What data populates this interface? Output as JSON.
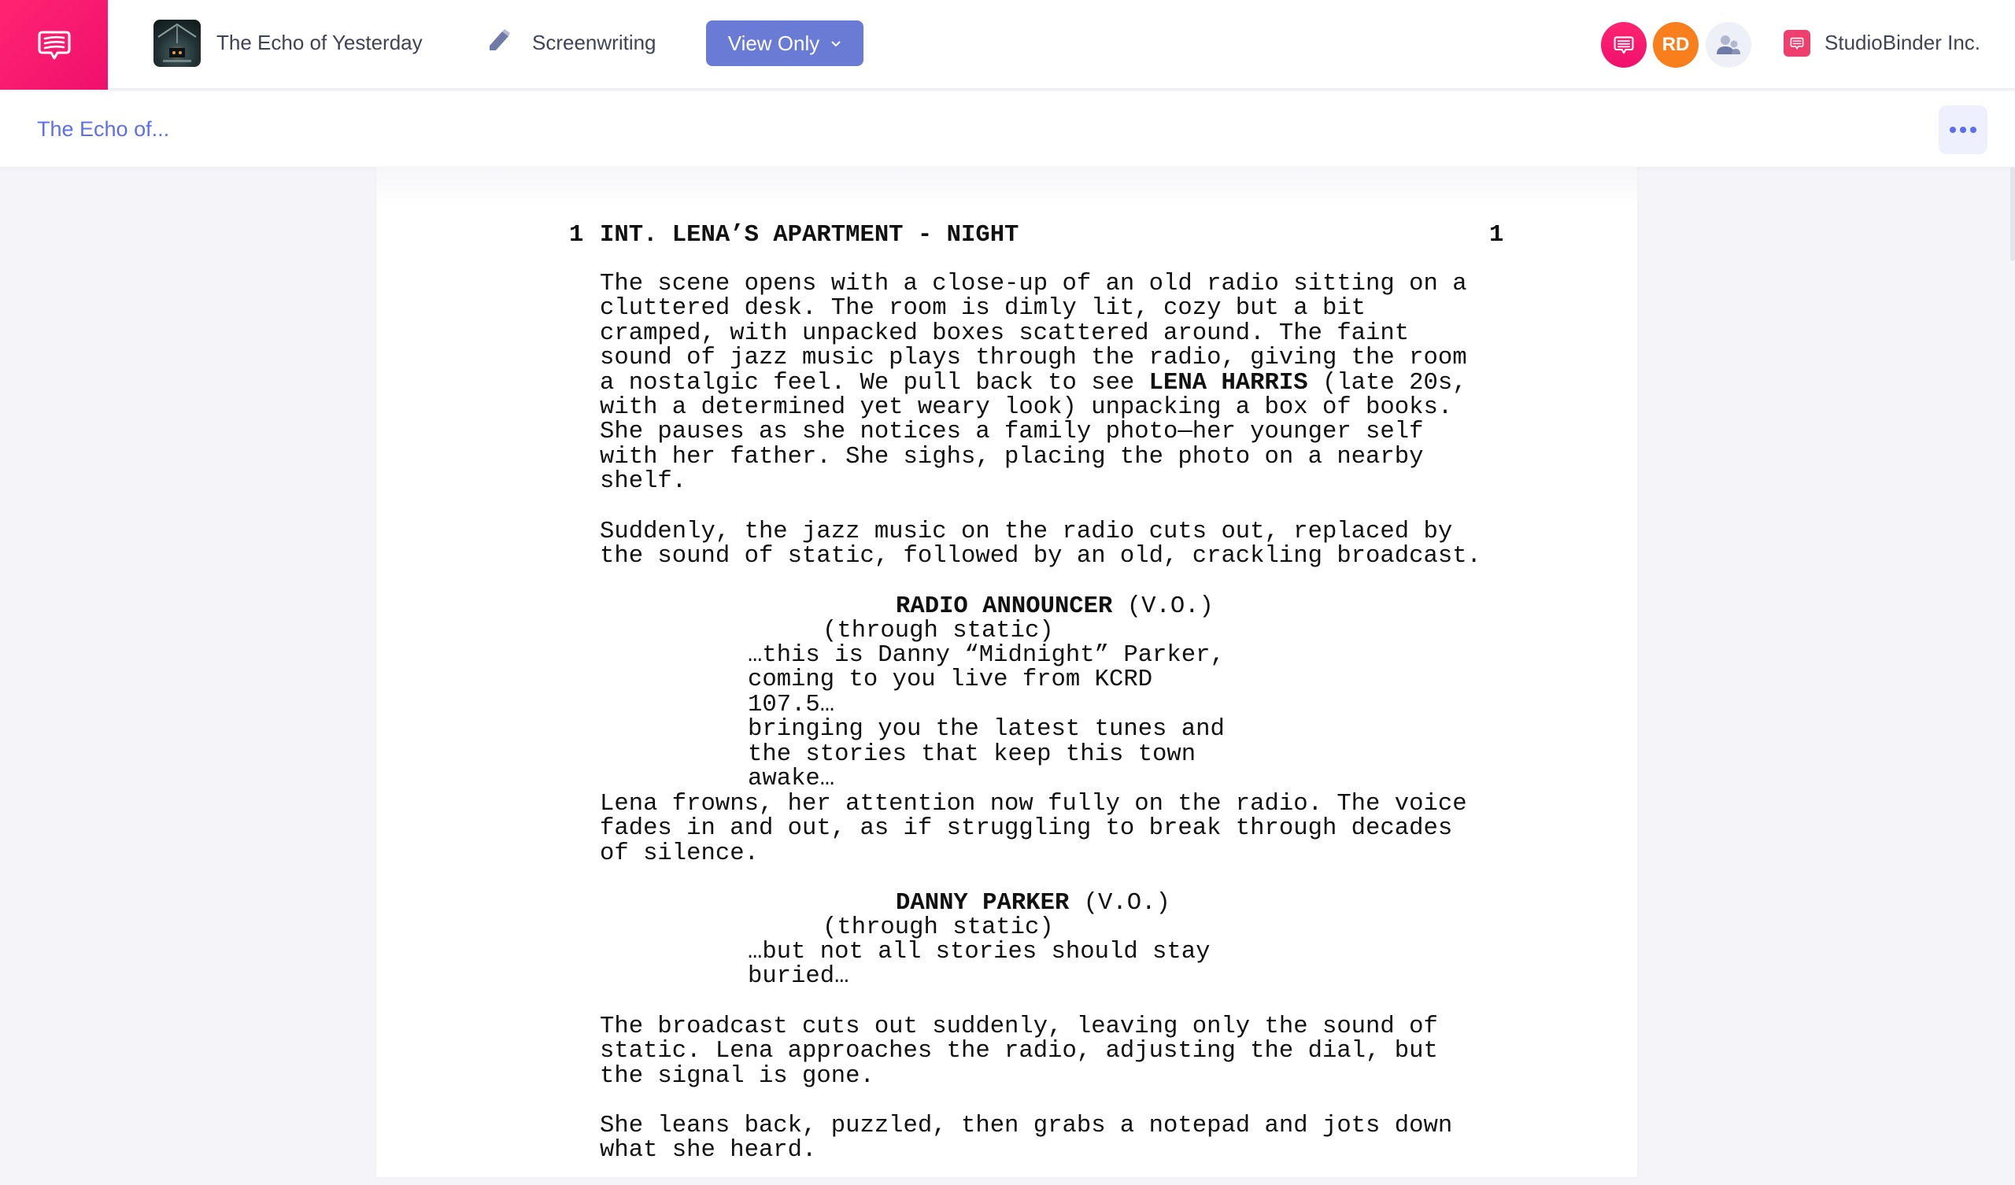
{
  "topbar": {
    "logo_icon": "chat-bubble-icon",
    "project_title": "The Echo of Yesterday",
    "module_icon": "pencil-icon",
    "module_label": "Screenwriting",
    "view_mode_button": "View Only",
    "view_mode_chevron": "⌄",
    "avatars": [
      {
        "type": "logo",
        "icon": "chat-bubble-icon",
        "color": "#ff2470"
      },
      {
        "type": "initials",
        "label": "RD",
        "color": "#f97e1c"
      },
      {
        "type": "team",
        "icon": "users-icon",
        "color": "#eef0f8"
      }
    ],
    "org_name": "StudioBinder Inc."
  },
  "subbar": {
    "breadcrumb": "The Echo of...",
    "more_icon": "ellipsis-icon"
  },
  "colors": {
    "brand_pink": "#ff2470",
    "accent_blue": "#5b6ff0",
    "button_blue": "#6a7bd6",
    "avatar_orange": "#f97e1c"
  },
  "script": {
    "scene": {
      "number_left": "1",
      "heading": "INT. LENA’S APARTMENT - NIGHT",
      "number_right": "1"
    },
    "action_1": {
      "before_bold": "The scene opens with a close-up of an old radio sitting on a\ncluttered desk. The room is dimly lit, cozy but a bit\ncramped, with unpacked boxes scattered around. The faint\nsound of jazz music plays through the radio, giving the room\na nostalgic feel. We pull back to see ",
      "bold": "LENA HARRIS",
      "after_bold": " (late 20s,\nwith a determined yet weary look) unpacking a box of books.\nShe pauses as she notices a family photo—her younger self\nwith her father. She sighs, placing the photo on a nearby\nshelf."
    },
    "action_2": "Suddenly, the jazz music on the radio cuts out, replaced by\nthe sound of static, followed by an old, crackling broadcast.",
    "dialogue_1": {
      "character": "RADIO ANNOUNCER",
      "extension": " (V.O.)",
      "parenthetical": "(through static)",
      "text": "…this is Danny “Midnight” Parker,\ncoming to you live from KCRD 107.5…\nbringing you the latest tunes and\nthe stories that keep this town\nawake…"
    },
    "action_3": "Lena frowns, her attention now fully on the radio. The voice\nfades in and out, as if struggling to break through decades\nof silence.",
    "dialogue_2": {
      "character": "DANNY PARKER",
      "extension": " (V.O.)",
      "parenthetical": "(through static)",
      "text": "…but not all stories should stay\nburied…"
    },
    "action_4": "The broadcast cuts out suddenly, leaving only the sound of\nstatic. Lena approaches the radio, adjusting the dial, but\nthe signal is gone.",
    "action_5": "She leans back, puzzled, then grabs a notepad and jots down\nwhat she heard."
  }
}
